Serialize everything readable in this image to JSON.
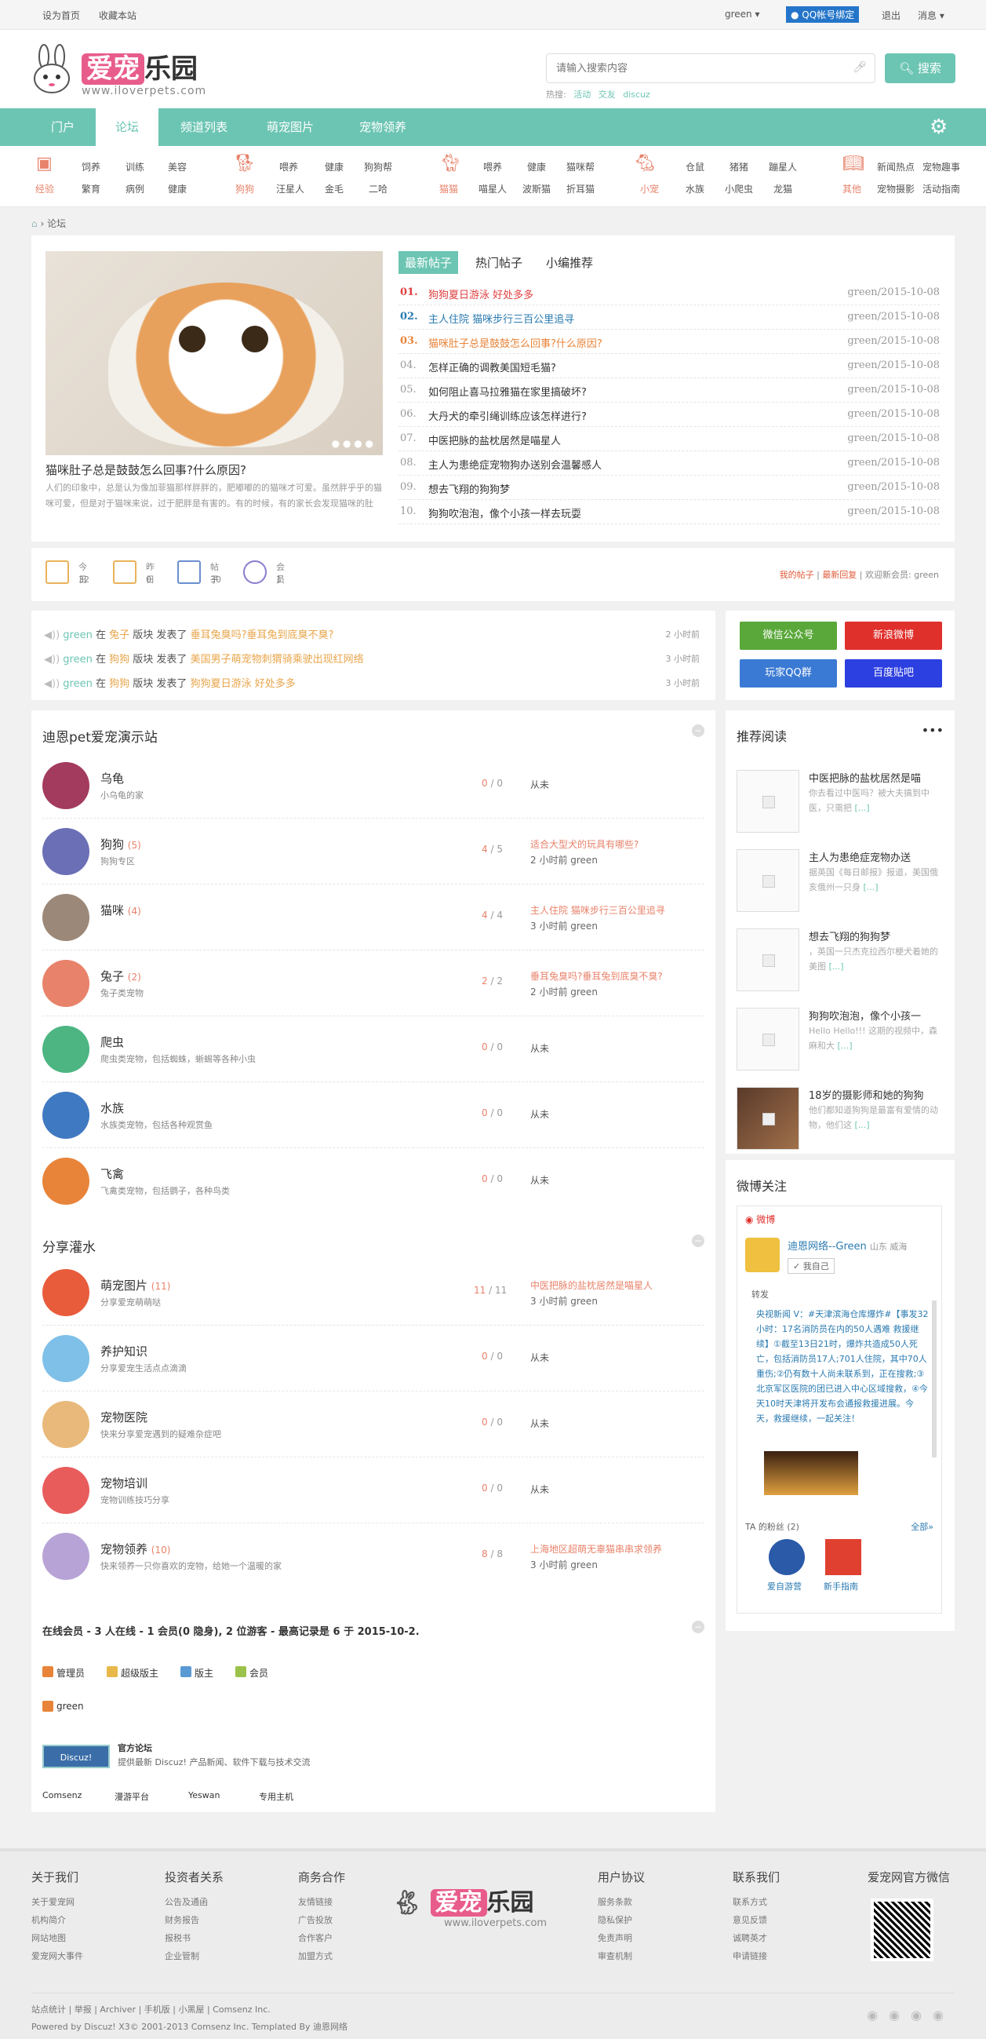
{
  "topbar": {
    "home": "设为首页",
    "fav": "收藏本站",
    "user": "green",
    "qq": "QQ帐号绑定",
    "logout": "退出",
    "msg": "消息"
  },
  "logo": {
    "a": "爱宠",
    "b": "乐园",
    "url": "www.iloverpets.com"
  },
  "search": {
    "placeholder": "请输入搜索内容",
    "button": "搜索",
    "hot_label": "热搜:",
    "hot": [
      "活动",
      "交友",
      "discuz"
    ]
  },
  "nav": [
    "门户",
    "论坛",
    "频道列表",
    "萌宠图片",
    "宠物领养"
  ],
  "cats": {
    "jy": {
      "label": "经验",
      "items": [
        "饲养",
        "训练",
        "美容",
        "繁育",
        "病例",
        "健康"
      ]
    },
    "gg": {
      "label": "狗狗",
      "items": [
        "喂养",
        "健康",
        "狗狗帮",
        "汪星人",
        "金毛",
        "二哈"
      ]
    },
    "mm": {
      "label": "猫猫",
      "items": [
        "喂养",
        "健康",
        "猫咪帮",
        "喵星人",
        "波斯猫",
        "折耳猫"
      ]
    },
    "xc": {
      "label": "小宠",
      "items": [
        "仓鼠",
        "猪猪",
        "蹦星人",
        "水族",
        "小爬虫",
        "龙猫"
      ]
    },
    "qt": {
      "label": "其他",
      "items": [
        "新闻热点",
        "宠物趣事",
        "宠物摄影",
        "活动指南"
      ]
    }
  },
  "crumb": "论坛",
  "hero": {
    "caption": "猫咪肚子总是鼓鼓怎么回事?什么原因?",
    "desc": "人们的印象中，总是认为像加菲猫那样胖胖的，肥嘟嘟的的猫咪才可爱。虽然胖乎乎的猫咪可爱，但是对于猫咪来说，过于肥胖是有害的。有的时候，有的家长会发现猫咪的肚",
    "tabs": [
      "最新帖子",
      "热门帖子",
      "小编推荐"
    ]
  },
  "news": [
    {
      "n": "01.",
      "t": "狗狗夏日游泳 好处多多",
      "d": "green/2015-10-08"
    },
    {
      "n": "02.",
      "t": "主人住院 猫咪步行三百公里追寻",
      "d": "green/2015-10-08"
    },
    {
      "n": "03.",
      "t": "猫咪肚子总是鼓鼓怎么回事?什么原因?",
      "d": "green/2015-10-08"
    },
    {
      "n": "04.",
      "t": "怎样正确的调教美国短毛猫?",
      "d": "green/2015-10-08"
    },
    {
      "n": "05.",
      "t": "如何阻止喜马拉雅猫在家里搞破坏?",
      "d": "green/2015-10-08"
    },
    {
      "n": "06.",
      "t": "大丹犬的牵引绳训练应该怎样进行?",
      "d": "green/2015-10-08"
    },
    {
      "n": "07.",
      "t": "中医把脉的盐枕居然是喵星人",
      "d": "green/2015-10-08"
    },
    {
      "n": "08.",
      "t": "主人为患绝症宠物狗办送别会温馨感人",
      "d": "green/2015-10-08"
    },
    {
      "n": "09.",
      "t": "想去飞翔的狗狗梦",
      "d": "green/2015-10-08"
    },
    {
      "n": "10.",
      "t": "狗狗吹泡泡，像个小孩一样去玩耍",
      "d": "green/2015-10-08"
    }
  ],
  "stats": [
    {
      "k": "今日",
      "v": "32"
    },
    {
      "k": "昨日",
      "v": "0"
    },
    {
      "k": "帖子",
      "v": "30"
    },
    {
      "k": "会员",
      "v": "1"
    }
  ],
  "stats_right": {
    "my": "我的帖子",
    "latest": "最新回复",
    "welcome": "欢迎新会员: green"
  },
  "feed": [
    {
      "u": "green",
      "a": "在",
      "f": "兔子",
      "b": "版块 发表了",
      "t": "垂耳兔臭吗?垂耳兔到底臭不臭?",
      "time": "2 小时前"
    },
    {
      "u": "green",
      "a": "在",
      "f": "狗狗",
      "b": "版块 发表了",
      "t": "美国男子萌宠物刺猬骑乘驶出现红网络",
      "time": "3 小时前"
    },
    {
      "u": "green",
      "a": "在",
      "f": "狗狗",
      "b": "版块 发表了",
      "t": "狗狗夏日游泳 好处多多",
      "time": "3 小时前"
    }
  ],
  "share": [
    "微信公众号",
    "新浪微博",
    "玩家QQ群",
    "百度贴吧"
  ],
  "sec1": "迪恩pet爱宠演示站",
  "forums1": [
    {
      "name": "乌龟",
      "cnt": "",
      "desc": "小乌龟的家",
      "ct": "0",
      "ct2": "0",
      "last": "",
      "lastby": "",
      "never": "从未",
      "color": "#a33b5f"
    },
    {
      "name": "狗狗",
      "cnt": "(5)",
      "desc": "狗狗专区",
      "ct": "4",
      "ct2": "5",
      "last": "适合大型犬的玩具有哪些?",
      "lastby": "2 小时前 green",
      "never": "",
      "color": "#6b6fb5"
    },
    {
      "name": "猫咪",
      "cnt": "(4)",
      "desc": "",
      "ct": "4",
      "ct2": "4",
      "last": "主人住院 猫咪步行三百公里追寻",
      "lastby": "3 小时前 green",
      "never": "",
      "color": "#9b8878"
    },
    {
      "name": "兔子",
      "cnt": "(2)",
      "desc": "兔子类宠物",
      "ct": "2",
      "ct2": "2",
      "last": "垂耳兔臭吗?垂耳兔到底臭不臭?",
      "lastby": "2 小时前 green",
      "never": "",
      "color": "#e8826a"
    },
    {
      "name": "爬虫",
      "cnt": "",
      "desc": "爬虫类宠物，包括蜘蛛，蜥蜴等各种小虫",
      "ct": "0",
      "ct2": "0",
      "last": "",
      "lastby": "",
      "never": "从未",
      "color": "#4cb582"
    },
    {
      "name": "水族",
      "cnt": "",
      "desc": "水族类宠物，包括各种观赏鱼",
      "ct": "0",
      "ct2": "0",
      "last": "",
      "lastby": "",
      "never": "从未",
      "color": "#3f79c1"
    },
    {
      "name": "飞禽",
      "cnt": "",
      "desc": "飞禽类宠物，包括鹦子，各种鸟类",
      "ct": "0",
      "ct2": "0",
      "last": "",
      "lastby": "",
      "never": "从未",
      "color": "#e8843a"
    }
  ],
  "sec2": "分享灌水",
  "forums2": [
    {
      "name": "萌宠图片",
      "cnt": "(11)",
      "desc": "分享爱宠萌萌哒",
      "ct": "11",
      "ct2": "11",
      "last": "中医把脉的盐枕居然是喵星人",
      "lastby": "3 小时前 green",
      "never": "",
      "color": "#e85c3c"
    },
    {
      "name": "养护知识",
      "cnt": "",
      "desc": "分享爱宠生活点点滴滴",
      "ct": "0",
      "ct2": "0",
      "last": "",
      "lastby": "",
      "never": "从未",
      "color": "#7ec0e8"
    },
    {
      "name": "宠物医院",
      "cnt": "",
      "desc": "快来分享爱宠遇到的疑难杂症吧",
      "ct": "0",
      "ct2": "0",
      "last": "",
      "lastby": "",
      "never": "从未",
      "color": "#e8b97a"
    },
    {
      "name": "宠物培训",
      "cnt": "",
      "desc": "宠物训练技巧分享",
      "ct": "0",
      "ct2": "0",
      "last": "",
      "lastby": "",
      "never": "从未",
      "color": "#e85c5c"
    },
    {
      "name": "宠物领养",
      "cnt": "(10)",
      "desc": "快来领养一只你喜欢的宠物，给她一个温暖的家",
      "ct": "8",
      "ct2": "8",
      "last": "上海地区超萌无辜猫串串求领养",
      "lastby": "3 小时前 green",
      "never": "",
      "color": "#b7a3d6"
    }
  ],
  "online": "在线会员 - 3 人在线 - 1 会员(0 隐身), 2 位游客 - 最高记录是 6 于 2015-10-2.",
  "legend": [
    "管理员",
    "超级版主",
    "版主",
    "会员"
  ],
  "online_user": "green",
  "official": {
    "name": "官方论坛",
    "desc": "提供最新 Discuz! 产品新闻、软件下载与技术交流",
    "logo": "Discuz!"
  },
  "links": [
    "Comsenz",
    "漫游平台",
    "Yeswan",
    "专用主机"
  ],
  "recommend": {
    "title": "推荐阅读",
    "items": [
      {
        "t": "中医把脉的盐枕居然是喵",
        "x": "你去看过中医吗？被大夫搞到中医，只需把"
      },
      {
        "t": "主人为患绝症宠物办送",
        "x": "据英国《每日邮报》报道，美国俄亥俄州一只身"
      },
      {
        "t": "想去飞翔的狗狗梦",
        "x": "，英国一只杰克拉西尔梗犬着她的美图"
      },
      {
        "t": "狗狗吹泡泡，像个小孩一",
        "x": "Hello Hello!!! 这期的视频中，森麻和大"
      },
      {
        "t": "18岁的摄影师和她的狗狗",
        "x": "他们都知道狗狗是最富有爱情的动物，他们这"
      }
    ],
    "more": "[...]"
  },
  "weibo": {
    "title": "微博关注",
    "brand": "微博",
    "name": "迪恩网络--Green",
    "loc": "山东 威海",
    "follow": "我自己",
    "box": "转发",
    "post": "央视新闻 V：#天津滨海仓库爆炸#【事发32小时：17名消防员在内的50人遇难 救援继续】①截至13日21时，爆炸共造成50人死亡，包括消防员17人;701人住院，其中70人重伤;②仍有数十人尚未联系到，正在搜救;③北京军区医院的团已进入中心区域搜救，④今天10时天津将开发布会通报救援进展。今天，救援继续，一起关注！",
    "fans": "TA 的粉丝 (2)",
    "all": "全部»",
    "f1": "爱自游营",
    "f2": "新手指南"
  },
  "footer": {
    "cols": [
      {
        "h": "关于我们",
        "items": [
          "关于爱宠网",
          "机构简介",
          "网站地图",
          "爱宠网大事件"
        ]
      },
      {
        "h": "投资者关系",
        "items": [
          "公告及通函",
          "财务报告",
          "报税书",
          "企业管制"
        ]
      },
      {
        "h": "商务合作",
        "items": [
          "友情链接",
          "广告投放",
          "合作客户",
          "加盟方式"
        ]
      },
      {
        "h": "用户协议",
        "items": [
          "服务条款",
          "隐私保护",
          "免责声明",
          "审查机制"
        ]
      },
      {
        "h": "联系我们",
        "items": [
          "联系方式",
          "意见反馈",
          "诚聘英才",
          "申请链接"
        ]
      },
      {
        "h": "爱宠网官方微信",
        "items": []
      }
    ],
    "links": "站点统计 | 举报 | Archiver | 手机版 | 小黑屋 | Comsenz Inc.",
    "copy": "Powered by Discuz! X3© 2001-2013 Comsenz Inc. Templated By 迪恩网络"
  }
}
